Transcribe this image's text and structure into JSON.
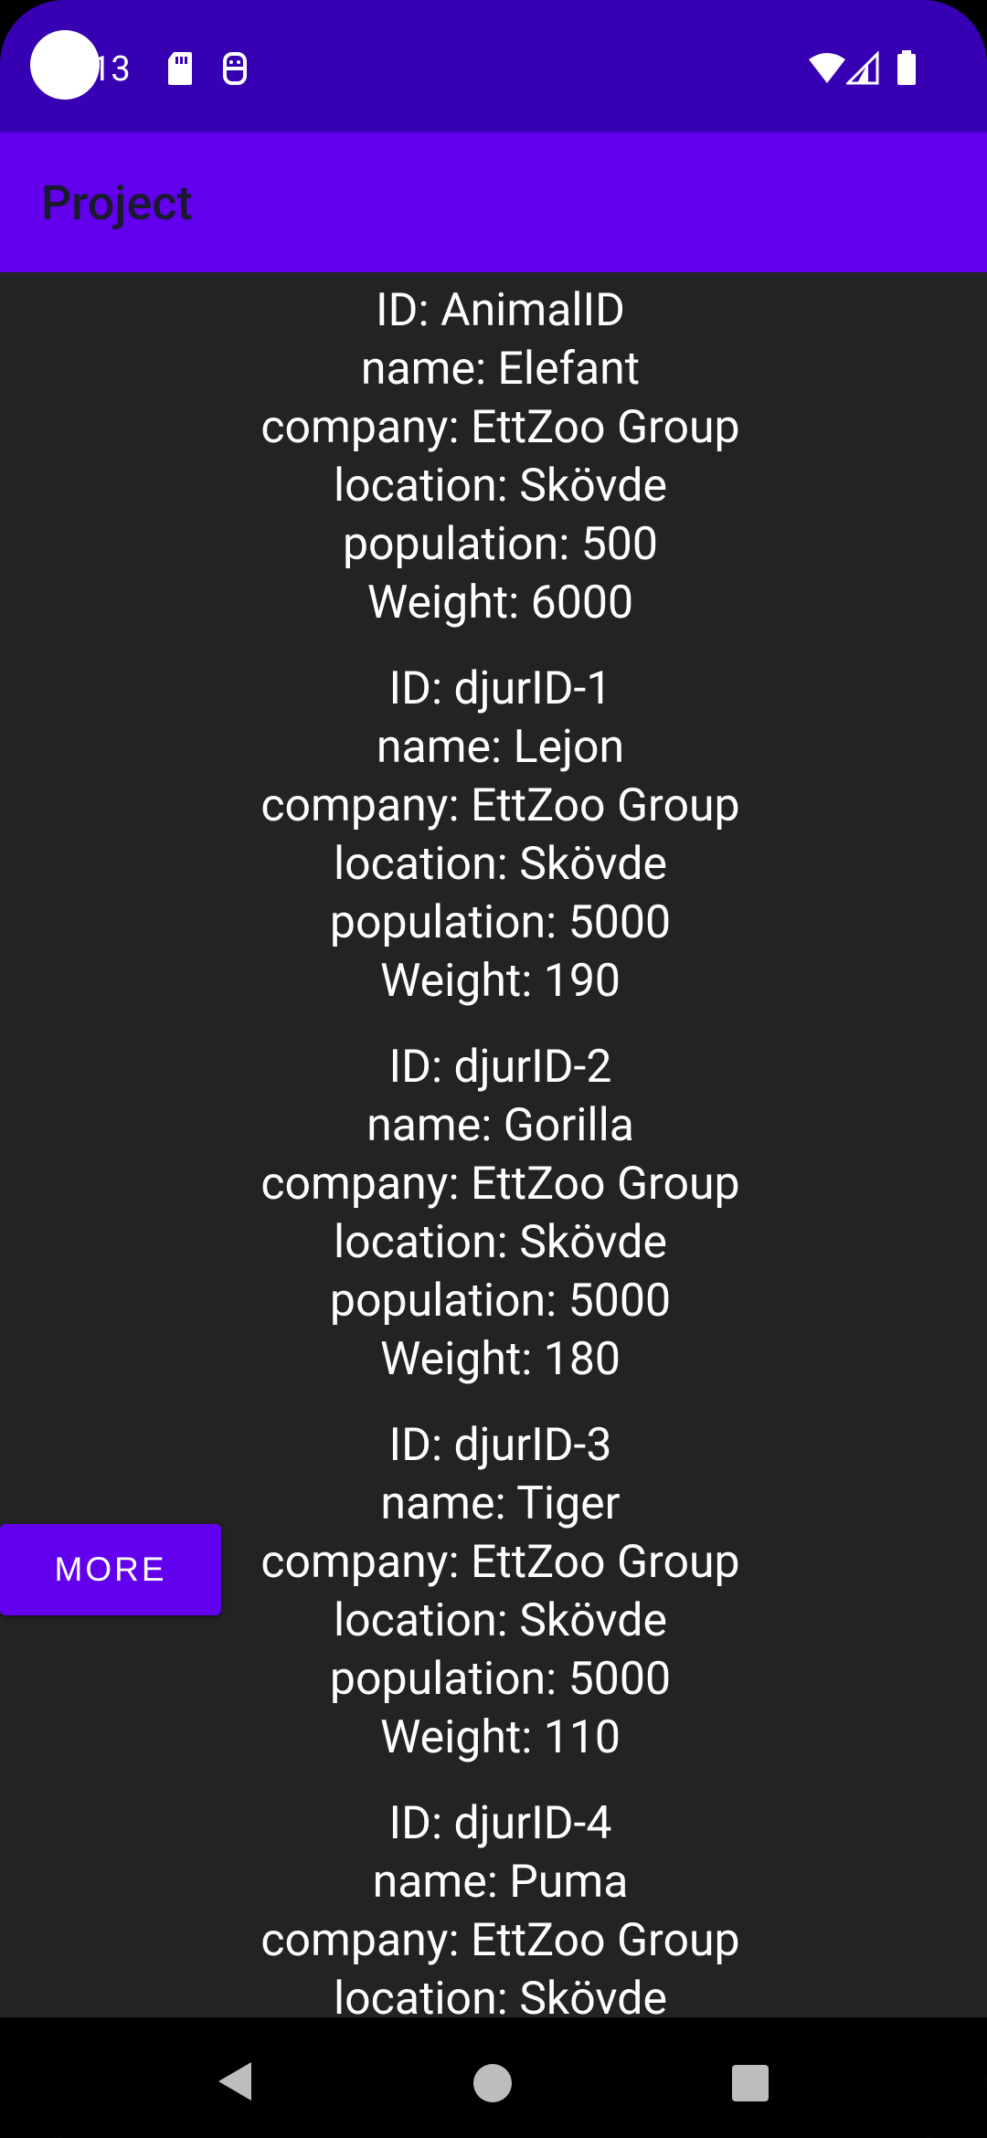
{
  "status_bar": {
    "time": "13",
    "icons": [
      "sd-card-icon",
      "face-icon",
      "wifi-icon",
      "cell-signal-icon",
      "battery-icon"
    ]
  },
  "app_bar": {
    "title": "Project"
  },
  "animals": [
    {
      "id": "ID: AnimalID",
      "name": "name: Elefant",
      "company": "company: EttZoo Group",
      "location": "location: Skövde",
      "population": "population: 500",
      "weight": "Weight: 6000"
    },
    {
      "id": "ID: djurID-1",
      "name": "name: Lejon",
      "company": "company: EttZoo Group",
      "location": "location: Skövde",
      "population": "population: 5000",
      "weight": "Weight: 190"
    },
    {
      "id": "ID: djurID-2",
      "name": "name: Gorilla",
      "company": "company: EttZoo Group",
      "location": "location: Skövde",
      "population": "population: 5000",
      "weight": "Weight: 180"
    },
    {
      "id": "ID: djurID-3",
      "name": "name: Tiger",
      "company": "company: EttZoo Group",
      "location": "location: Skövde",
      "population": "population: 5000",
      "weight": "Weight: 110"
    },
    {
      "id": "ID: djurID-4",
      "name": "name: Puma",
      "company": "company: EttZoo Group",
      "location": "location: Skövde",
      "population": "",
      "weight": ""
    }
  ],
  "more_button": {
    "label": "MORE"
  },
  "colors": {
    "status_bar": "#3700B3",
    "app_bar": "#6200EE",
    "background": "#232323"
  }
}
